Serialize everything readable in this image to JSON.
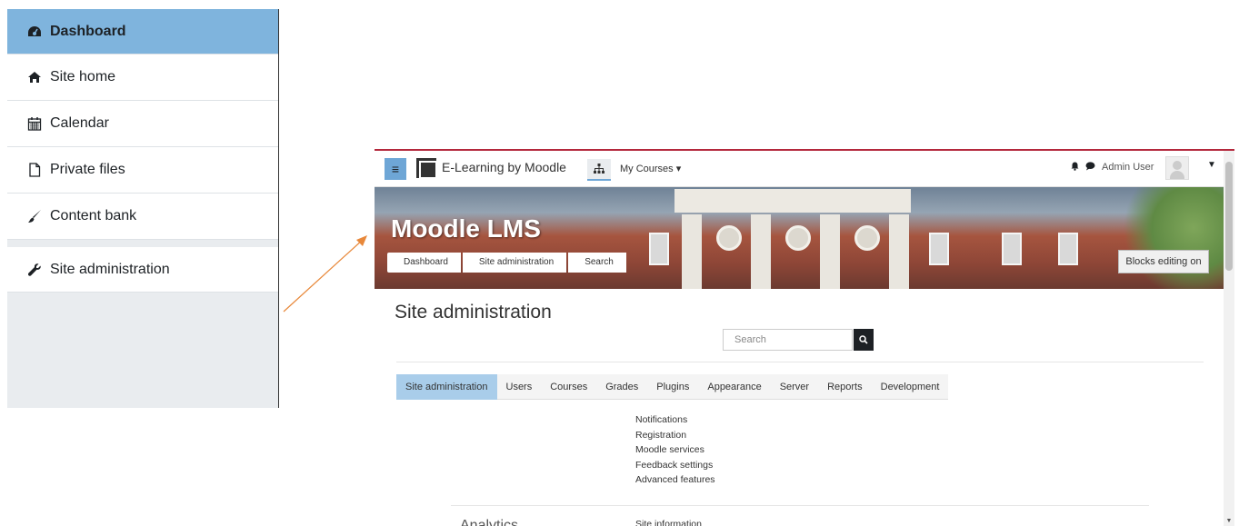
{
  "drawer": {
    "items": [
      {
        "label": "Dashboard",
        "icon": "dashboard-icon"
      },
      {
        "label": "Site home",
        "icon": "home-icon"
      },
      {
        "label": "Calendar",
        "icon": "calendar-icon"
      },
      {
        "label": "Private files",
        "icon": "file-icon"
      },
      {
        "label": "Content bank",
        "icon": "brush-icon"
      },
      {
        "label": "Site administration",
        "icon": "wrench-icon"
      }
    ]
  },
  "navbar": {
    "site_name": "E-Learning by Moodle",
    "my_courses": "My Courses",
    "user_name": "Admin User"
  },
  "header": {
    "title": "Moodle LMS",
    "breadcrumb": [
      "Dashboard",
      "Site administration",
      "Search"
    ],
    "blocks_editing_button": "Blocks editing on"
  },
  "main": {
    "title": "Site administration",
    "search_placeholder": "Search",
    "tabs": [
      "Site administration",
      "Users",
      "Courses",
      "Grades",
      "Plugins",
      "Appearance",
      "Server",
      "Reports",
      "Development"
    ],
    "links": [
      "Notifications",
      "Registration",
      "Moodle services",
      "Feedback settings",
      "Advanced features"
    ],
    "section_title": "Analytics",
    "section_link": "Site information"
  },
  "colors": {
    "active_drawer": "#7fb4dd",
    "active_tab": "#a9cdea",
    "navbar_accent": "#b4283c",
    "arrow": "#e8883a"
  }
}
